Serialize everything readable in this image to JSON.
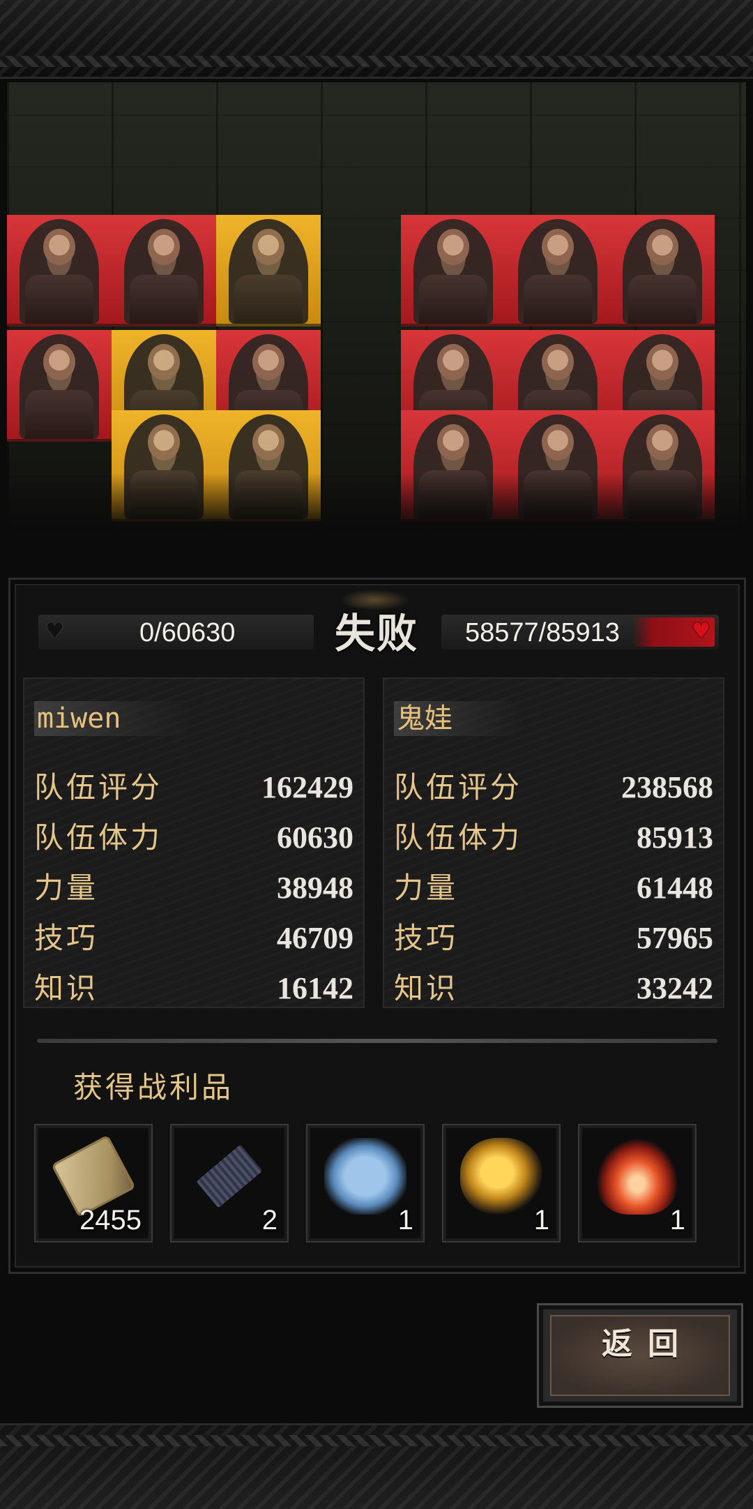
{
  "battle": {
    "left_team_hp": "0/60630",
    "right_team_hp": "58577/85913",
    "result": "失败"
  },
  "left_team": {
    "name": "miwen",
    "stats": [
      {
        "label": "队伍评分",
        "value": "162429"
      },
      {
        "label": "队伍体力",
        "value": "60630"
      },
      {
        "label": "力量",
        "value": "38948"
      },
      {
        "label": "技巧",
        "value": "46709"
      },
      {
        "label": "知识",
        "value": "16142"
      }
    ]
  },
  "right_team": {
    "name": "鬼娃",
    "stats": [
      {
        "label": "队伍评分",
        "value": "238568"
      },
      {
        "label": "队伍体力",
        "value": "85913"
      },
      {
        "label": "力量",
        "value": "61448"
      },
      {
        "label": "技巧",
        "value": "57965"
      },
      {
        "label": "知识",
        "value": "33242"
      }
    ]
  },
  "loot": {
    "title": "获得战利品",
    "items": [
      {
        "icon": "scroll-icon",
        "qty": "2455"
      },
      {
        "icon": "blueprint-icon",
        "qty": "2"
      },
      {
        "icon": "crystal-icon",
        "qty": "1"
      },
      {
        "icon": "gold-nugget-icon",
        "qty": "1"
      },
      {
        "icon": "flame-gem-icon",
        "qty": "1"
      }
    ]
  },
  "buttons": {
    "return_label": "返回"
  },
  "colors": {
    "card_red": "#d8363a",
    "card_gold": "#f0b42a",
    "label_gold": "#e6c58b",
    "hp_red": "#b2141c"
  }
}
